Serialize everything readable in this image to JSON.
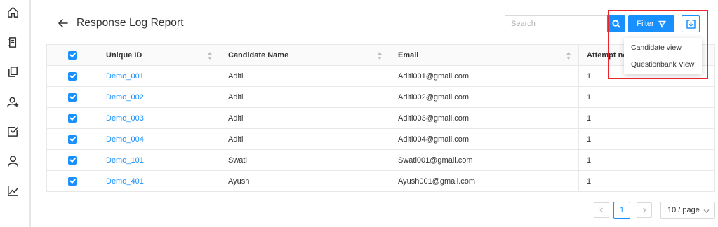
{
  "header": {
    "title": "Response Log Report",
    "search_placeholder": "Search",
    "filter_label": "Filter"
  },
  "filter_menu": {
    "items": [
      "Candidate view",
      "Questionbank View"
    ]
  },
  "sidebar": {
    "icons": [
      "home-icon",
      "report-icon",
      "copy-icon",
      "add-user-icon",
      "checkbox-icon",
      "user-icon",
      "chart-icon"
    ]
  },
  "table": {
    "columns": [
      "Unique ID",
      "Candidate Name",
      "Email",
      "Attempt no"
    ],
    "rows": [
      {
        "id": "Demo_001",
        "name": "Aditi",
        "email": "Aditi001@gmail.com",
        "attempt": "1"
      },
      {
        "id": "Demo_002",
        "name": "Aditi",
        "email": "Aditi002@gmail.com",
        "attempt": "1"
      },
      {
        "id": "Demo_003",
        "name": "Aditi",
        "email": "Aditi003@gmail.com",
        "attempt": "1"
      },
      {
        "id": "Demo_004",
        "name": "Aditi",
        "email": "Aditi004@gmail.com",
        "attempt": "1"
      },
      {
        "id": "Demo_101",
        "name": "Swati",
        "email": "Swati001@gmail.com",
        "attempt": "1"
      },
      {
        "id": "Demo_401",
        "name": "Ayush",
        "email": "Ayush001@gmail.com",
        "attempt": "1"
      }
    ]
  },
  "pagination": {
    "current_page": "1",
    "page_size": "10 / page"
  },
  "colors": {
    "accent": "#1890ff",
    "highlight": "#e8262c"
  }
}
